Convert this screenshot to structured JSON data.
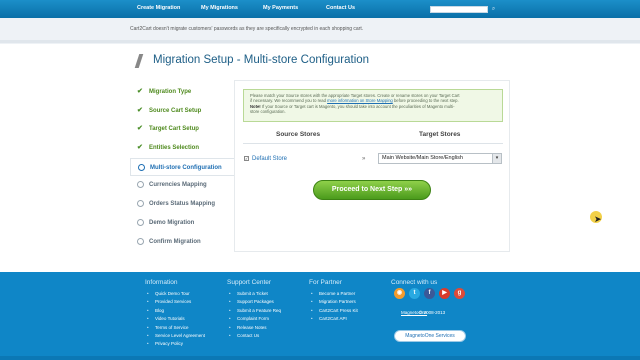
{
  "topnav": {
    "items": [
      "Create Migration",
      "My Migrations",
      "My Payments",
      "Contact Us"
    ],
    "search_placeholder": "",
    "search_icon": "search-icon"
  },
  "notice": "Cart2Cart doesn't migrate customers' passwords as they are specifically encrypted in each shopping cart.",
  "page_title": "Migration Setup - Multi-store Configuration",
  "steps": [
    {
      "label": "Migration Type",
      "state": "done"
    },
    {
      "label": "Source Cart Setup",
      "state": "done"
    },
    {
      "label": "Target Cart Setup",
      "state": "done"
    },
    {
      "label": "Entities Selection",
      "state": "done"
    },
    {
      "label": "Multi-store Configuration",
      "state": "active"
    },
    {
      "label": "Currencies Mapping",
      "state": "todo"
    },
    {
      "label": "Orders Status Mapping",
      "state": "todo"
    },
    {
      "label": "Demo Migration",
      "state": "todo"
    },
    {
      "label": "Confirm Migration",
      "state": "todo"
    }
  ],
  "info": {
    "line1": "Please match your Source stores with the appropriate Target stores. Create or rename stores on your Target Cart",
    "line2_pre": "if necessary. We recommend you to read",
    "line2_link": "more information on Store Mapping",
    "line2_post": "before proceeding to the next step.",
    "note_label": "Note!",
    "note_text": "If your Source or Target cart is Magento, you should take into account the peculiarities of Magento multi-",
    "line4": "store configuration."
  },
  "columns": {
    "source": "Source Stores",
    "target": "Target Stores"
  },
  "mapping": {
    "source_store": "Default Store",
    "arrow": "»",
    "target_store": "Main Website/Main Store/English"
  },
  "proceed_button": "Proceed to Next Step »»",
  "footer": {
    "information": {
      "title": "Information",
      "links": [
        "Quick Demo Tour",
        "Provided Services",
        "Blog",
        "Video Tutorials",
        "Terms of Service",
        "Service Level Agreement",
        "Privacy Policy"
      ]
    },
    "support": {
      "title": "Support Center",
      "links": [
        "Submit a Ticket",
        "Support Packages",
        "Submit a Feature Req",
        "Complaint Form",
        "Release Notes",
        "Contact Us"
      ]
    },
    "partner": {
      "title": "For Partner",
      "links": [
        "Become a Partner",
        "Migration Partners",
        "Cart2Cart Press Kit",
        "Cart2Cart API"
      ]
    },
    "connect": {
      "title": "Connect with us",
      "icons": [
        "rss-icon",
        "twitter-icon",
        "facebook-icon",
        "youtube-icon",
        "google-plus-icon"
      ],
      "magneto": "MagnetoOne",
      "copyright": "© 2008-2013",
      "services_button": "MagnetoOne Services"
    }
  },
  "colors": {
    "nav_blue": "#1c8fc9",
    "footer_blue": "#0f86c7",
    "step_green": "#4f8a1e",
    "active_blue": "#1f6fb3",
    "button_green": "#6cb832"
  }
}
